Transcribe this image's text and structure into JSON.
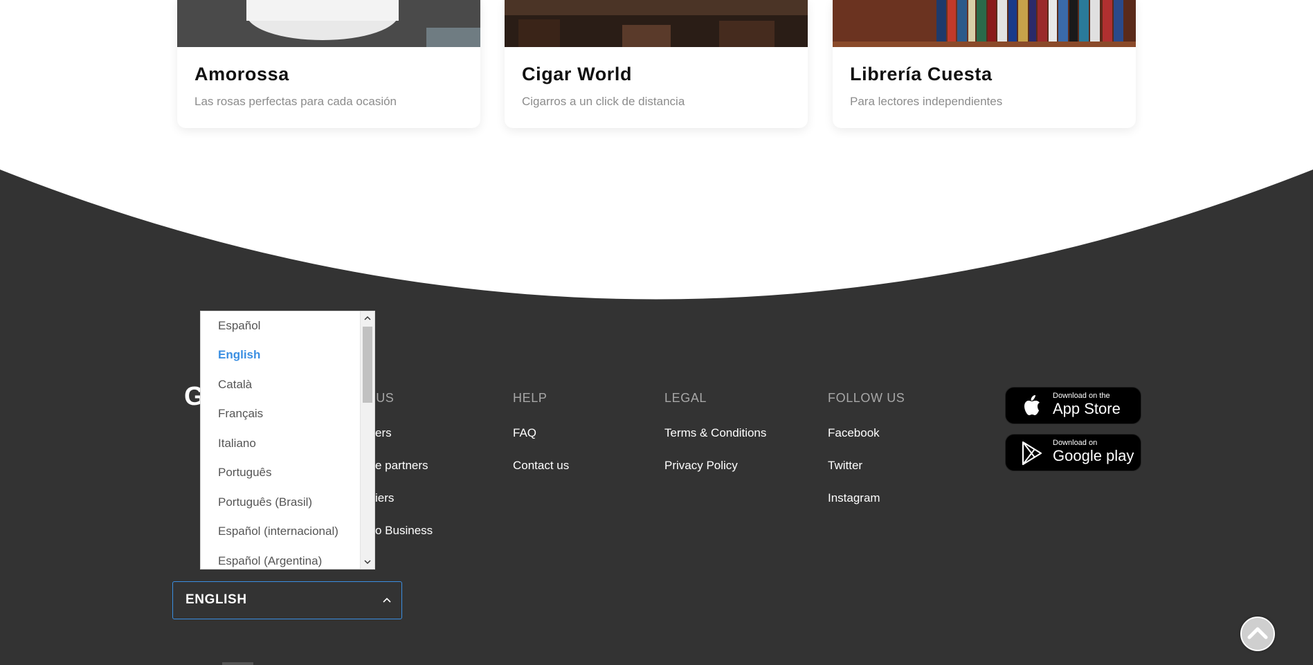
{
  "cards": [
    {
      "title": "Amorossa",
      "subtitle": "Las rosas perfectas para cada ocasión"
    },
    {
      "title": "Cigar World",
      "subtitle": "Cigarros a un click de distancia"
    },
    {
      "title": "Librería Cuesta",
      "subtitle": "Para lectores independientes"
    }
  ],
  "footer": {
    "logo_partial": "G",
    "join_us": {
      "heading_partial": "N US",
      "links": [
        "ers",
        "e partners",
        "iers",
        "o Business"
      ]
    },
    "help": {
      "heading": "HELP",
      "links": [
        "FAQ",
        "Contact us"
      ]
    },
    "legal": {
      "heading": "LEGAL",
      "links": [
        "Terms & Conditions",
        "Privacy Policy"
      ]
    },
    "follow": {
      "heading": "FOLLOW US",
      "links": [
        "Facebook",
        "Twitter",
        "Instagram"
      ]
    },
    "app_store": {
      "small": "Download on the",
      "big": "App Store"
    },
    "google_play": {
      "small": "Download on",
      "big": "Google play"
    }
  },
  "language": {
    "selected": "ENGLISH",
    "options": [
      "Español",
      "English",
      "Català",
      "Français",
      "Italiano",
      "Português",
      "Português (Brasil)",
      "Español (internacional)",
      "Español (Argentina)"
    ],
    "highlighted": "English"
  },
  "colors": {
    "footer_bg": "#333333",
    "accent": "#3b8fe2"
  },
  "icons": {
    "apple": "apple-icon",
    "google_play": "google-play-icon",
    "scroll_top": "chevron-up-icon"
  }
}
